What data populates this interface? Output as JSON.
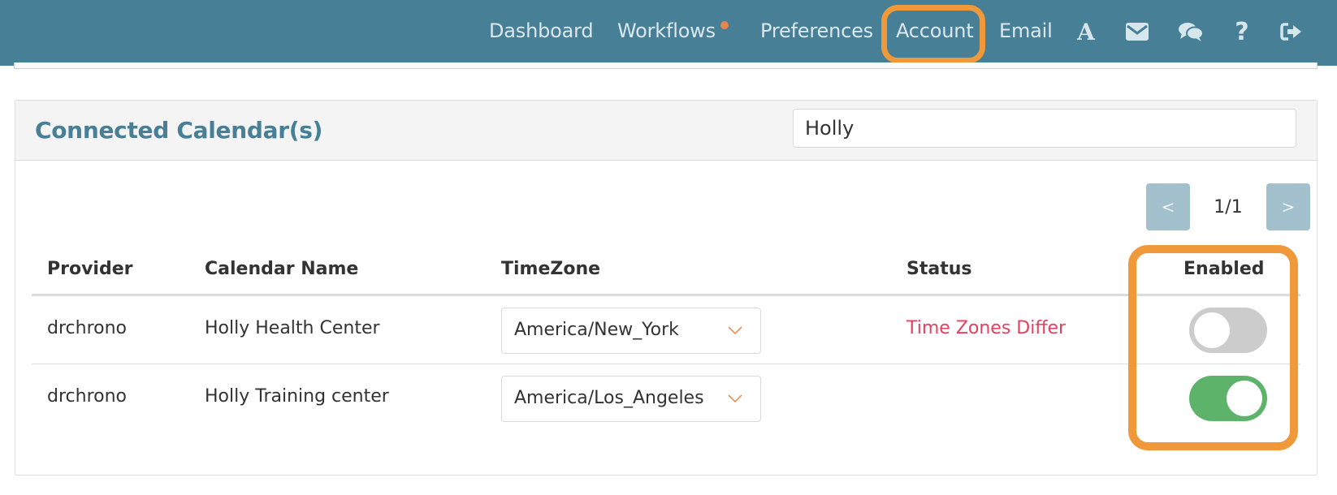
{
  "nav": {
    "items": [
      {
        "label": "Dashboard"
      },
      {
        "label": "Workflows",
        "has_notification": true
      },
      {
        "label": "Preferences"
      },
      {
        "label": "Account",
        "highlighted": true
      },
      {
        "label": "Email"
      }
    ],
    "icons": [
      {
        "name": "font-icon",
        "glyph": "A"
      },
      {
        "name": "envelope-icon",
        "glyph": "envelope"
      },
      {
        "name": "chat-icon",
        "glyph": "comments"
      },
      {
        "name": "help-icon",
        "glyph": "?"
      },
      {
        "name": "logout-icon",
        "glyph": "sign-out"
      }
    ],
    "colors": {
      "bar": "#467f96",
      "text": "#dbe8ee",
      "notification": "#e8834a",
      "highlight": "#f0993a"
    }
  },
  "panel": {
    "title": "Connected Calendar(s)",
    "search": {
      "value": "Holly",
      "placeholder": ""
    },
    "pagination": {
      "prev_label": "<",
      "page_label": "1/1",
      "next_label": ">"
    }
  },
  "table": {
    "columns": [
      "Provider",
      "Calendar Name",
      "TimeZone",
      "Status",
      "Enabled"
    ],
    "rows": [
      {
        "provider": "drchrono",
        "calendar_name": "Holly Health Center",
        "timezone": "America/New_York",
        "status": "Time Zones Differ",
        "enabled": false
      },
      {
        "provider": "drchrono",
        "calendar_name": "Holly Training center",
        "timezone": "America/Los_Angeles",
        "status": "",
        "enabled": true
      }
    ],
    "colors": {
      "status_warning": "#e5405f",
      "toggle_on": "#5eb36b",
      "toggle_off": "#cccccc"
    }
  }
}
